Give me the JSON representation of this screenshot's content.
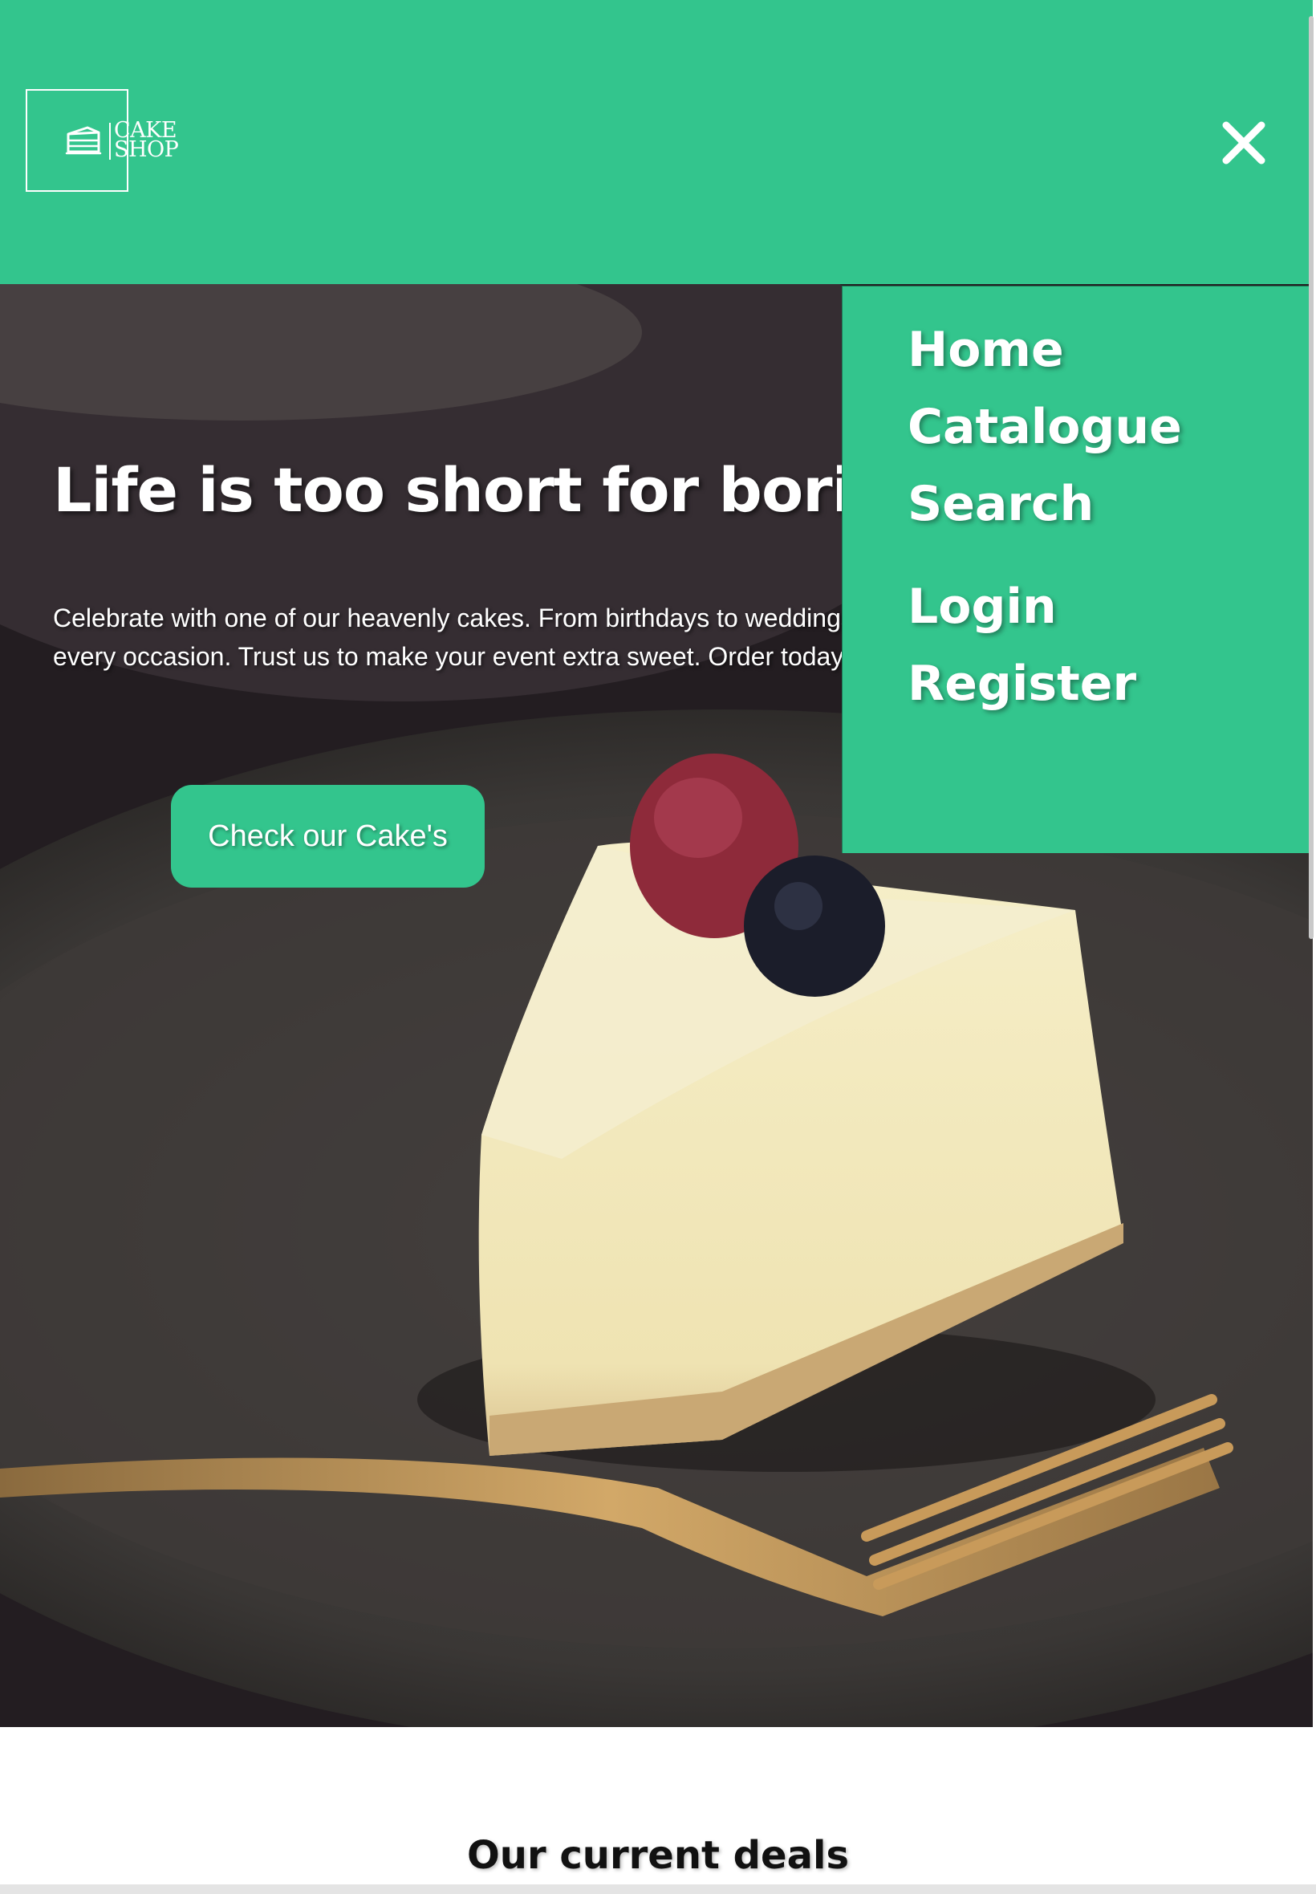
{
  "brand": {
    "logo_text_line1": "CAKE",
    "logo_text_line2": "SHOP"
  },
  "header": {
    "close_icon": "close-icon",
    "background_color": "#33c58d"
  },
  "hero": {
    "title": "Life is too short for boring cakes",
    "text": "Celebrate with one of our heavenly cakes. From birthdays to weddings, we have something for every occasion. Trust us to make your event extra sweet. Order today.",
    "cta_label": "Check our Cake's"
  },
  "nav": {
    "items": [
      {
        "label": "Home"
      },
      {
        "label": "Catalogue"
      },
      {
        "label": "Search"
      },
      {
        "label": "Login"
      },
      {
        "label": "Register"
      }
    ]
  },
  "deals": {
    "title": "Our current deals"
  },
  "colors": {
    "accent": "#33c58d",
    "text_light": "#ffffff"
  }
}
